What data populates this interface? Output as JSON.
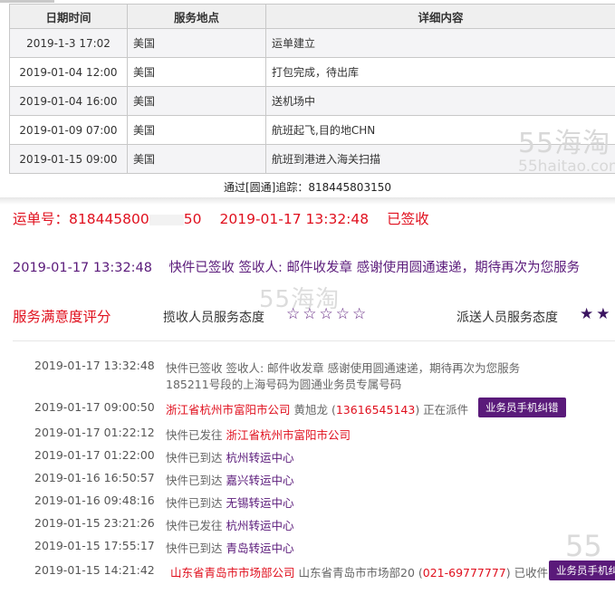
{
  "table": {
    "headers": [
      "日期时间",
      "服务地点",
      "详细内容"
    ],
    "rows": [
      {
        "time": "2019-1-3 17:02",
        "place": "美国",
        "detail": "运单建立"
      },
      {
        "time": "2019-01-04 12:00",
        "place": "美国",
        "detail": "打包完成，待出库"
      },
      {
        "time": "2019-01-04 16:00",
        "place": "美国",
        "detail": "送机场中"
      },
      {
        "time": "2019-01-09 07:00",
        "place": "美国",
        "detail": "航班起飞,目的地CHN"
      },
      {
        "time": "2019-01-15 09:00",
        "place": "美国",
        "detail": "航班到港进入海关扫描"
      }
    ],
    "note": "通过[圆通]追踪：818445803150"
  },
  "watermark": {
    "brand": "55海淘",
    "domain": "55haitao.com",
    "partial": "55"
  },
  "summary": {
    "waybill_label": "运单号：818445800",
    "waybill_tail": "50",
    "sign_time": "2019-01-17  13:32:48",
    "sign_status": "已签收",
    "latest_time": "2019-01-17  13:32:48",
    "latest_text": "快件已签收 签收人: 邮件收发章 感谢使用圆通速递，期待再次为您服务"
  },
  "rating": {
    "title": "服务满意度评分",
    "collect_label": "揽收人员服务态度",
    "collect_stars": "☆☆☆☆☆",
    "deliver_label": "派送人员服务态度",
    "deliver_stars": "★★"
  },
  "events": [
    {
      "time": "2019-01-17   13:32:48",
      "text": "快件已签收 签收人: 邮件收发章 感谢使用圆通速递，期待再次为您服务",
      "text2": "185211号段的上海号码为圆通业务员专属号码"
    },
    {
      "time": "2019-01-17   09:00:50",
      "place": "浙江省杭州市富阳市公司",
      "person": " 黄旭龙 (",
      "phone": "13616545143",
      "tail": ") 正在派件",
      "button": "业务员手机纠错"
    },
    {
      "time": "2019-01-17   01:22:12",
      "text": "快件已发往 ",
      "place": "浙江省杭州市富阳市公司"
    },
    {
      "time": "2019-01-17   01:22:00",
      "text": "快件已到达 ",
      "hub": "杭州转运中心"
    },
    {
      "time": "2019-01-16   16:50:57",
      "text": "快件已到达 ",
      "hub": "嘉兴转运中心"
    },
    {
      "time": "2019-01-16   09:48:16",
      "text": "快件已到达 ",
      "hub": "无锡转运中心"
    },
    {
      "time": "2019-01-15   23:21:26",
      "text": "快件已发往 ",
      "hub": "杭州转运中心"
    },
    {
      "time": "2019-01-15   17:55:17",
      "text": "快件已到达 ",
      "hub": "青岛转运中心"
    },
    {
      "time": "2019-01-15   14:21:42",
      "place": "山东省青岛市市场部公司",
      "person": " 山东省青岛市市场部20 (",
      "phone": "021-69777777",
      "tail": ") 已收件",
      "button": "业务员手机纠错"
    }
  ]
}
